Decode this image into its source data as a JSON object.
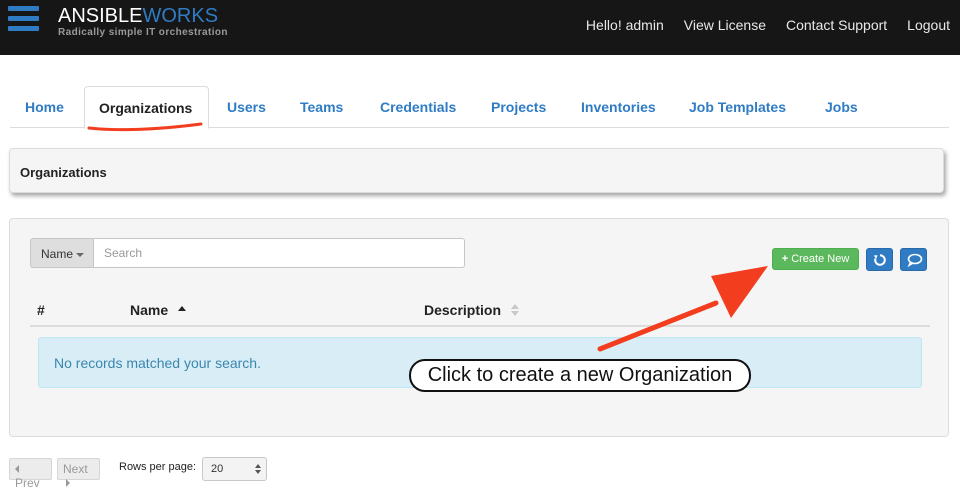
{
  "header": {
    "brand_main": "ANSIBLE",
    "brand_accent": "WORKS",
    "tagline": "Radically simple IT orchestration",
    "nav": [
      "Hello! admin",
      "View License",
      "Contact Support",
      "Logout"
    ]
  },
  "tabs": [
    "Home",
    "Organizations",
    "Users",
    "Teams",
    "Credentials",
    "Projects",
    "Inventories",
    "Job Templates",
    "Jobs"
  ],
  "active_tab": "Organizations",
  "breadcrumb": {
    "title": "Organizations"
  },
  "search": {
    "field_label": "Name",
    "placeholder": "Search",
    "value": ""
  },
  "toolbar": {
    "create_label": "Create New",
    "refresh_icon": "refresh-icon",
    "stream_icon": "activity-stream-icon"
  },
  "table": {
    "columns": [
      "#",
      "Name",
      "Description"
    ],
    "sort_column": "Name",
    "sort_direction": "ascending",
    "empty_message": "No records matched your search."
  },
  "annotation": {
    "text": "Click to create a new Organization",
    "color": "#f23d1f"
  },
  "pagination": {
    "prev_label": "Prev",
    "next_label": "Next",
    "rows_label": "Rows per page:",
    "rows_value": "20"
  },
  "colors": {
    "topbar": "#161616",
    "brand_blue": "#2f7cc4",
    "create_green": "#5cb85c",
    "alert_bg": "#d9edf7",
    "alert_text": "#3a87ad"
  }
}
